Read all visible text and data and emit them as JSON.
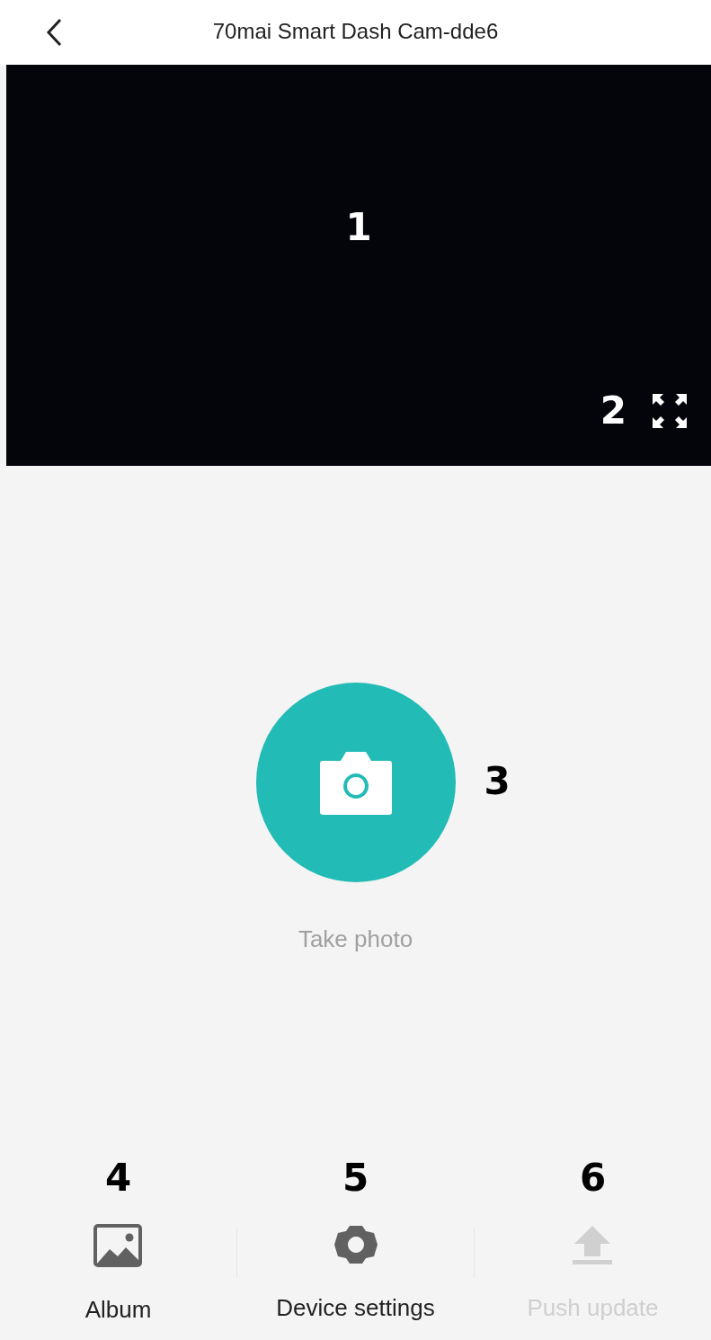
{
  "header": {
    "title": "70mai Smart Dash Cam-dde6"
  },
  "video": {
    "callout": "1",
    "fullscreen_callout": "2"
  },
  "capture": {
    "callout": "3",
    "label": "Take photo"
  },
  "bottom_bar": [
    {
      "kind": "album",
      "callout": "4",
      "label": "Album",
      "disabled": false
    },
    {
      "kind": "settings",
      "callout": "5",
      "label": "Device settings",
      "disabled": false
    },
    {
      "kind": "upload",
      "callout": "6",
      "label": "Push update",
      "disabled": true
    }
  ]
}
